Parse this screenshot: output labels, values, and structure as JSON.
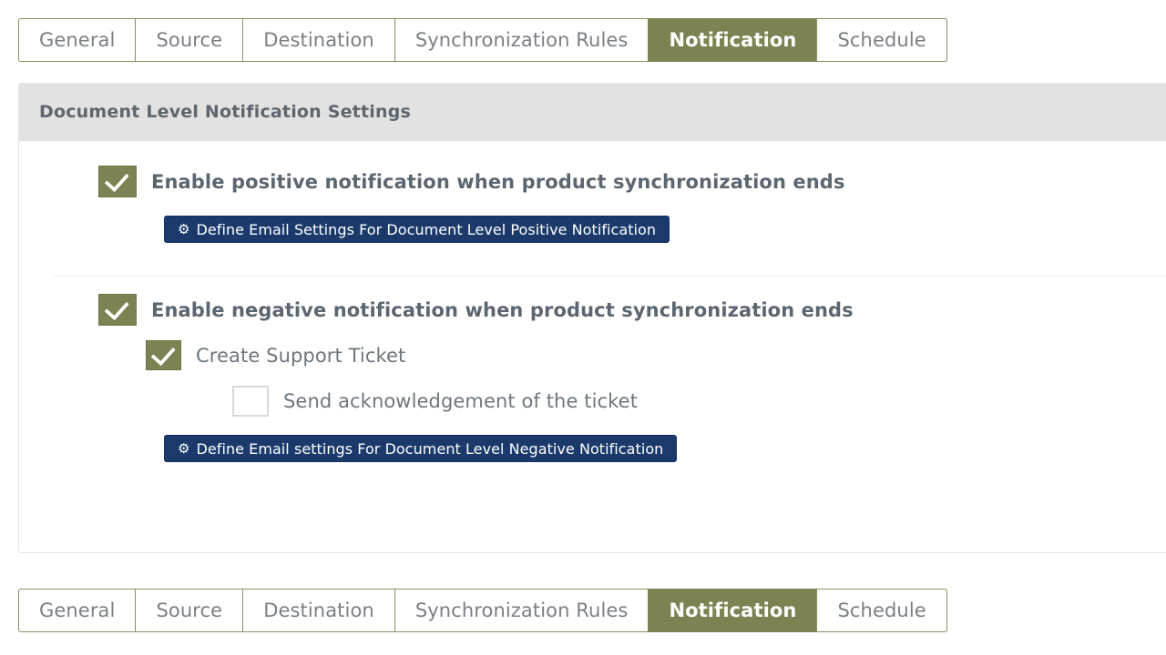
{
  "tabs": {
    "items": [
      {
        "label": "General",
        "active": false
      },
      {
        "label": "Source",
        "active": false
      },
      {
        "label": "Destination",
        "active": false
      },
      {
        "label": "Synchronization Rules",
        "active": false
      },
      {
        "label": "Notification",
        "active": true
      },
      {
        "label": "Schedule",
        "active": false
      }
    ]
  },
  "panel": {
    "header": "Document Level Notification Settings",
    "positive": {
      "checkbox_label": "Enable positive notification when product synchronization ends",
      "checked": true,
      "button_label": "Define Email Settings For Document Level Positive Notification",
      "button_icon": "gear-icon"
    },
    "negative": {
      "checkbox_label": "Enable negative notification when product synchronization ends",
      "checked": true,
      "support_ticket_label": "Create Support Ticket",
      "support_ticket_checked": true,
      "ack_label": "Send acknowledgement of the ticket",
      "ack_checked": false,
      "button_label": "Define Email settings For Document Level Negative Notification",
      "button_icon": "gear-icon"
    }
  },
  "colors": {
    "accent_olive": "#7d8252",
    "tab_border": "#8a8f5c",
    "button_blue": "#1b3a6b",
    "header_gray": "#e2e2e2",
    "text_slate": "#5c6670"
  },
  "icons": {
    "gear": "⚙"
  }
}
